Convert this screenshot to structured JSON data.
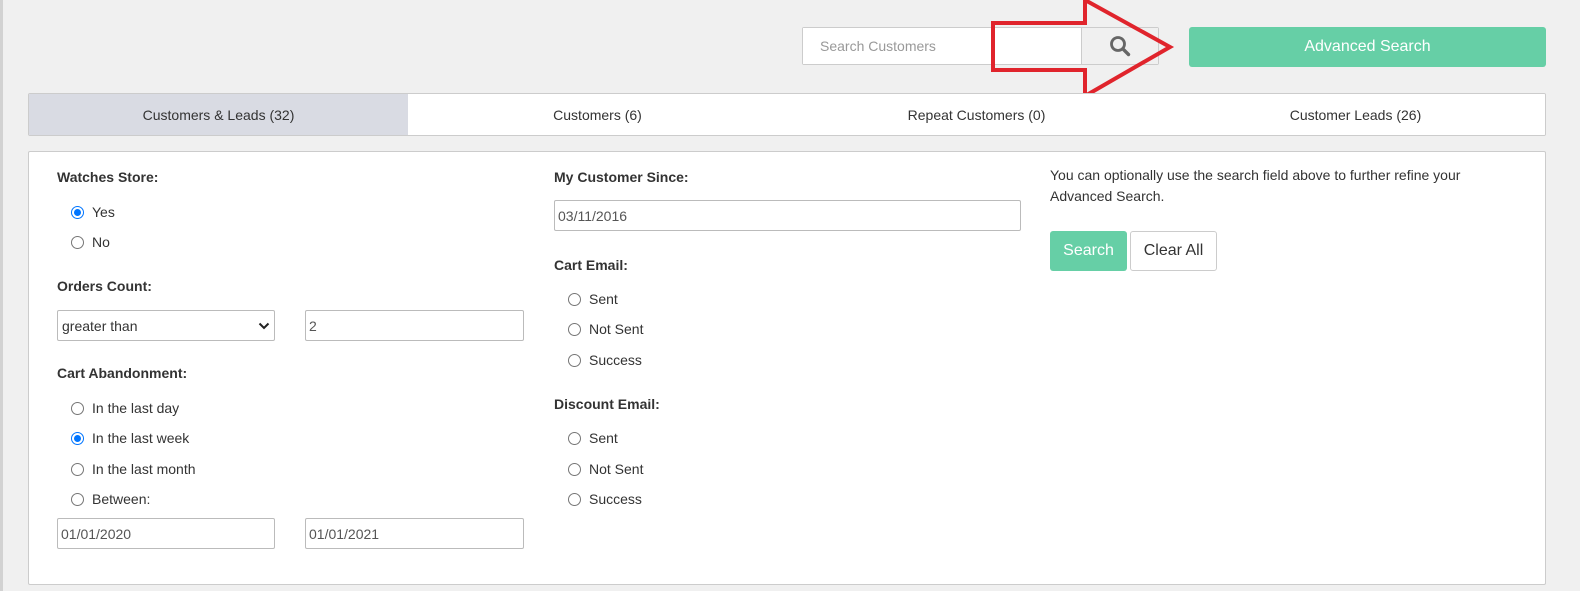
{
  "search": {
    "placeholder": "Search Customers",
    "value": ""
  },
  "advanced_search_label": "Advanced Search",
  "colors": {
    "accent": "#66cfa6",
    "annotation": "#e0242c",
    "active_tab": "#d9dbe3",
    "radio_checked": "#0075ff"
  },
  "tabs": [
    {
      "label": "Customers & Leads (32)",
      "active": true
    },
    {
      "label": "Customers (6)",
      "active": false
    },
    {
      "label": "Repeat Customers (0)",
      "active": false
    },
    {
      "label": "Customer Leads (26)",
      "active": false
    }
  ],
  "filters": {
    "watches_store": {
      "label": "Watches Store:",
      "options": [
        {
          "label": "Yes",
          "checked": true
        },
        {
          "label": "No",
          "checked": false
        }
      ]
    },
    "orders_count": {
      "label": "Orders Count:",
      "operator": "greater than",
      "value": "2"
    },
    "cart_abandonment": {
      "label": "Cart Abandonment:",
      "options": [
        {
          "label": "In the last day",
          "checked": false
        },
        {
          "label": "In the last week",
          "checked": true
        },
        {
          "label": "In the last month",
          "checked": false
        },
        {
          "label": "Between:",
          "checked": false
        }
      ],
      "from": "01/01/2020",
      "to": "01/01/2021"
    },
    "customer_since": {
      "label": "My Customer Since:",
      "value": "03/11/2016"
    },
    "cart_email": {
      "label": "Cart Email:",
      "options": [
        {
          "label": "Sent",
          "checked": false
        },
        {
          "label": "Not Sent",
          "checked": false
        },
        {
          "label": "Success",
          "checked": false
        }
      ]
    },
    "discount_email": {
      "label": "Discount Email:",
      "options": [
        {
          "label": "Sent",
          "checked": false
        },
        {
          "label": "Not Sent",
          "checked": false
        },
        {
          "label": "Success",
          "checked": false
        }
      ]
    }
  },
  "help_text": "You can optionally use the search field above to further refine your Advanced Search.",
  "actions": {
    "search_label": "Search",
    "clear_label": "Clear All"
  }
}
